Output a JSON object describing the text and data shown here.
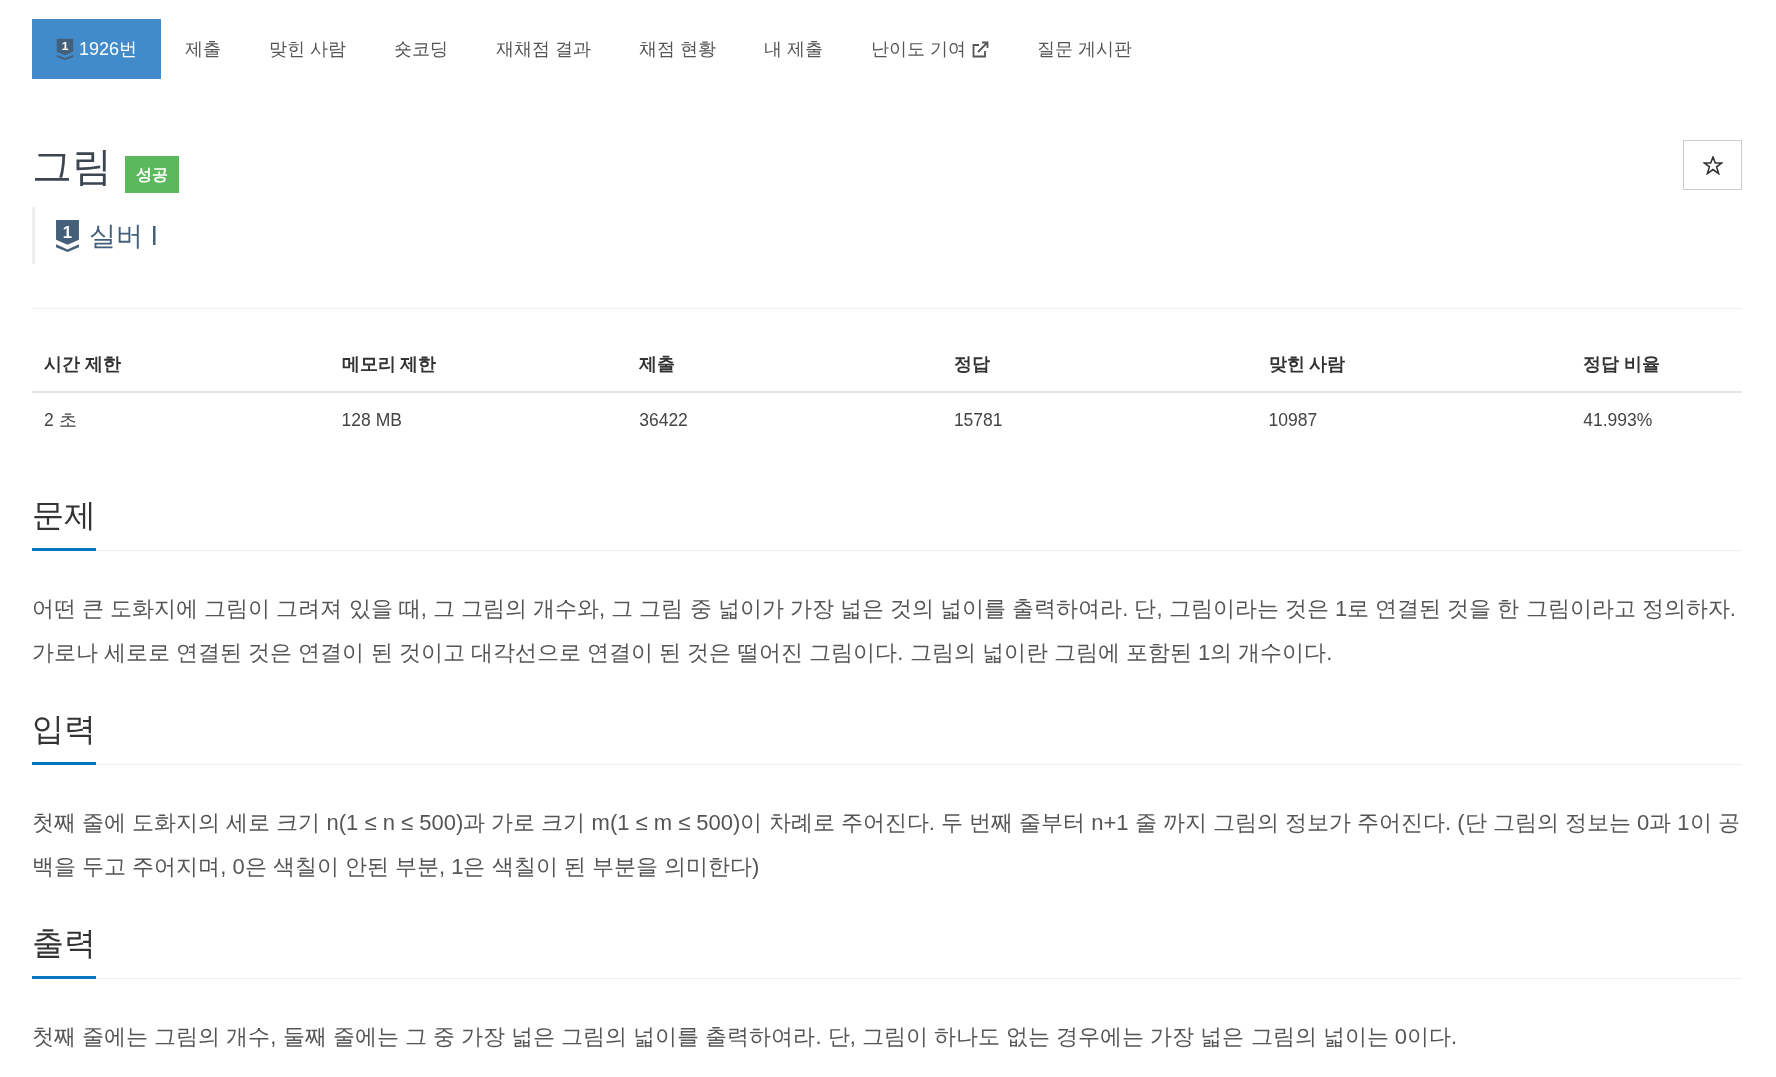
{
  "tabs": [
    {
      "label": "1926번",
      "selected": true,
      "icon_text": "1",
      "external": false
    },
    {
      "label": "제출",
      "selected": false,
      "external": false
    },
    {
      "label": "맞힌 사람",
      "selected": false,
      "external": false
    },
    {
      "label": "숏코딩",
      "selected": false,
      "external": false
    },
    {
      "label": "재채점 결과",
      "selected": false,
      "external": false
    },
    {
      "label": "채점 현황",
      "selected": false,
      "external": false
    },
    {
      "label": "내 제출",
      "selected": false,
      "external": false
    },
    {
      "label": "난이도 기여",
      "selected": false,
      "external": true
    },
    {
      "label": "질문 게시판",
      "selected": false,
      "external": false
    }
  ],
  "problem": {
    "title": "그림",
    "status_badge": "성공",
    "starred": false,
    "tier": {
      "icon_text": "1",
      "label": "실버 I"
    }
  },
  "stats": {
    "columns": [
      "시간 제한",
      "메모리 제한",
      "제출",
      "정답",
      "맞힌 사람",
      "정답 비율"
    ],
    "rows": [
      [
        "2 초",
        "128 MB",
        "36422",
        "15781",
        "10987",
        "41.993%"
      ]
    ]
  },
  "sections": [
    {
      "heading": "문제",
      "text": "어떤 큰 도화지에 그림이 그려져 있을 때, 그 그림의 개수와, 그 그림 중 넓이가 가장 넓은 것의 넓이를 출력하여라. 단, 그림이라는 것은 1로 연결된 것을 한 그림이라고 정의하자. 가로나 세로로 연결된 것은 연결이 된 것이고 대각선으로 연결이 된 것은 떨어진 그림이다. 그림의 넓이란 그림에 포함된 1의 개수이다."
    },
    {
      "heading": "입력",
      "text": "첫째 줄에 도화지의 세로 크기 n(1 ≤ n ≤ 500)과 가로 크기 m(1 ≤ m ≤ 500)이 차례로 주어진다. 두 번째 줄부터 n+1 줄 까지 그림의 정보가 주어진다. (단 그림의 정보는 0과 1이 공백을 두고 주어지며, 0은 색칠이 안된 부분, 1은 색칠이 된 부분을 의미한다)"
    },
    {
      "heading": "출력",
      "text": "첫째 줄에는 그림의 개수, 둘째 줄에는 그 중 가장 넓은 그림의 넓이를 출력하여라. 단, 그림이 하나도 없는 경우에는 가장 넓은 그림의 넓이는 0이다."
    }
  ]
}
